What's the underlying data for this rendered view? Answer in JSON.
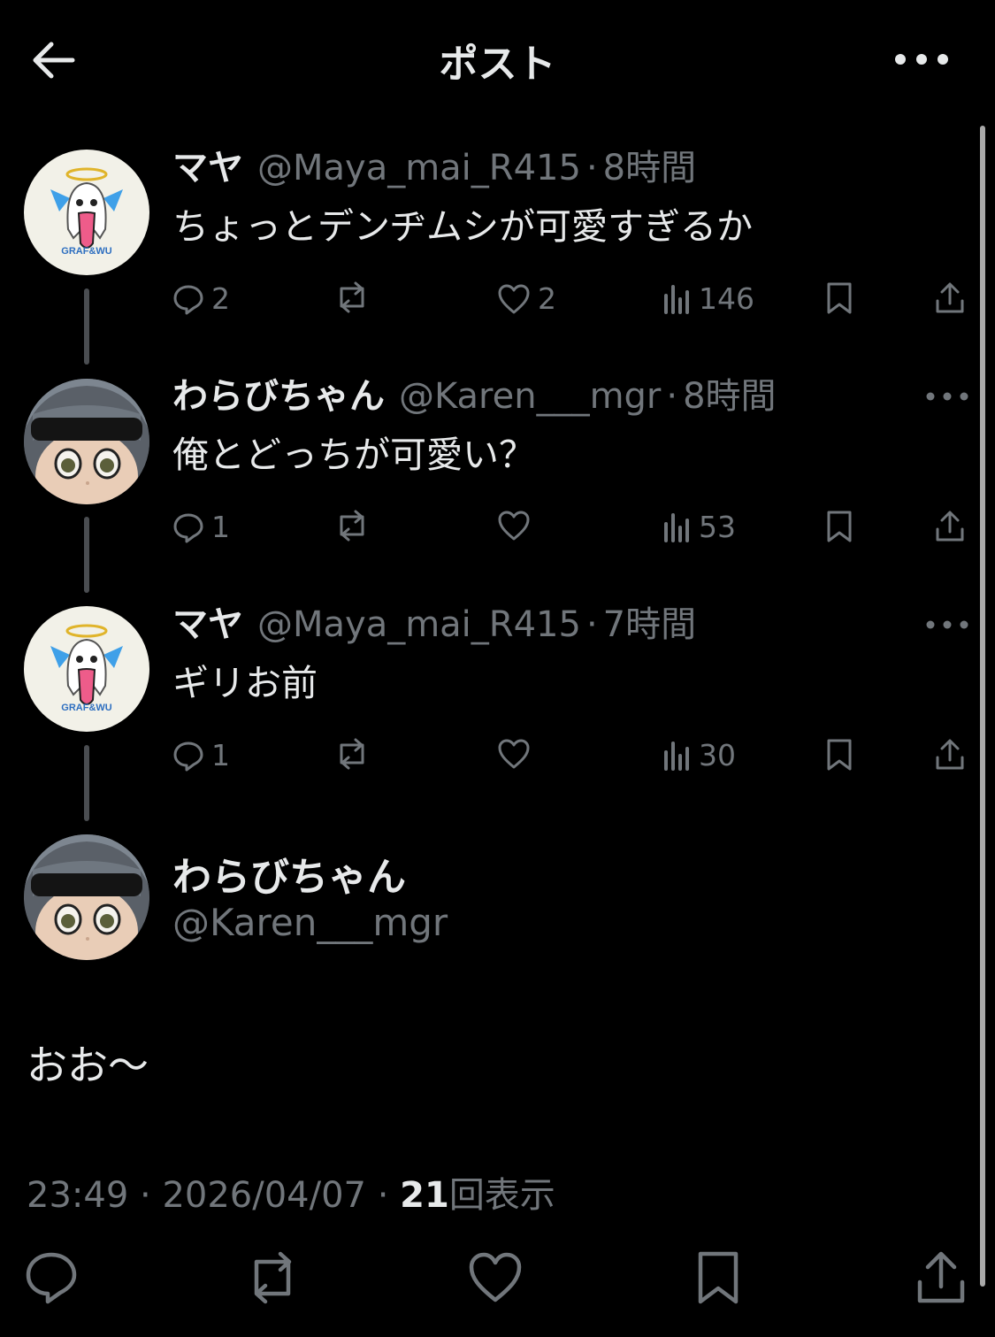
{
  "header": {
    "title": "ポスト"
  },
  "thread": [
    {
      "name": "マヤ",
      "handle": "@Maya_mai_R415",
      "time": "8時間",
      "text": "ちょっとデンヂムシが可愛すぎるか",
      "replies": "2",
      "reposts": "",
      "likes": "2",
      "views": "146",
      "avatar_text": "GRAF&WU"
    },
    {
      "name": "わらびちゃん",
      "handle": "@Karen___mgr",
      "time": "8時間",
      "text": "俺とどっちが可愛い？",
      "replies": "1",
      "reposts": "",
      "likes": "",
      "views": "53"
    },
    {
      "name": "マヤ",
      "handle": "@Maya_mai_R415",
      "time": "7時間",
      "text": "ギリお前",
      "replies": "1",
      "reposts": "",
      "likes": "",
      "views": "30",
      "avatar_text": "GRAF&WU"
    }
  ],
  "focus": {
    "name": "わらびちゃん",
    "handle": "@Karen___mgr",
    "text": "おお〜",
    "time": "23:49",
    "date": "2026/04/07",
    "views": "21",
    "views_label": "回表示"
  },
  "colors": {
    "background": "#000000",
    "text": "#e7e9ea",
    "muted": "#71767b",
    "thread_line": "#4a4d51"
  }
}
